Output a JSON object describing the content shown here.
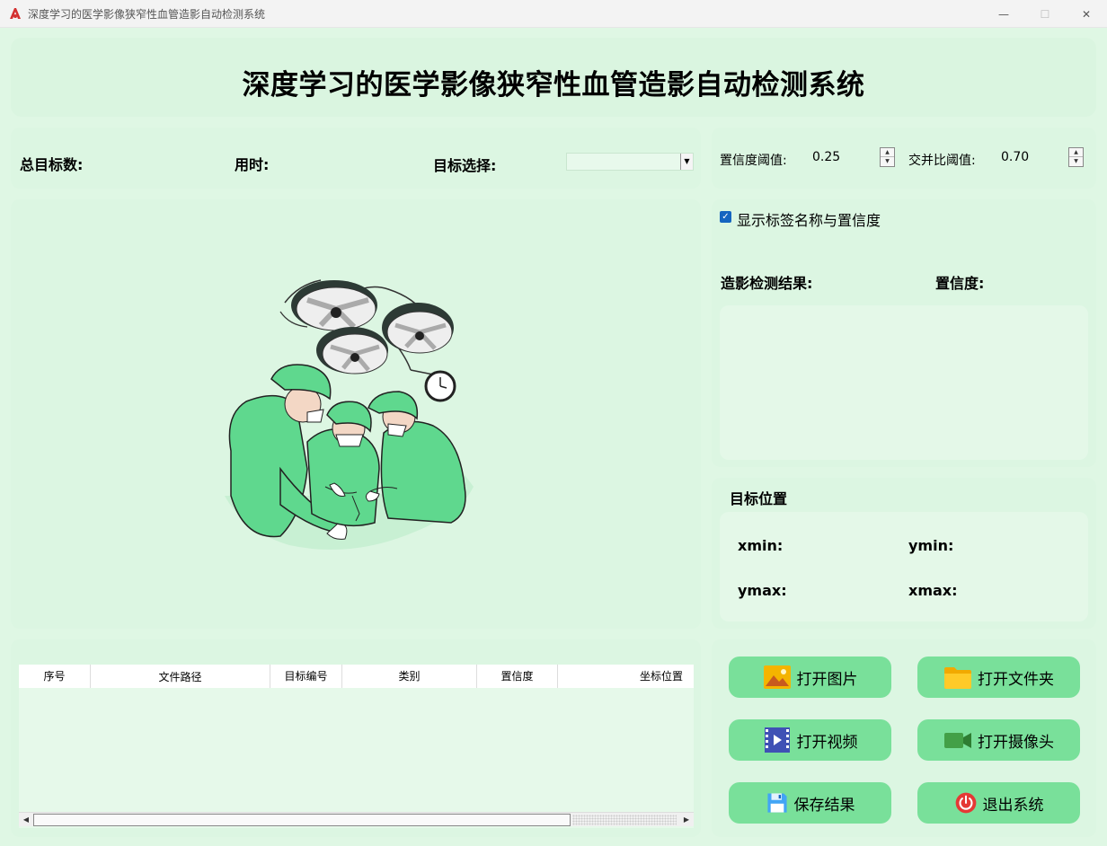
{
  "window": {
    "title": "深度学习的医学影像狭窄性血管造影自动检测系统",
    "minimize": "—",
    "maximize": "☐",
    "close": "✕"
  },
  "header": {
    "title": "深度学习的医学影像狭窄性血管造影自动检测系统"
  },
  "stats": {
    "total_targets_label": "总目标数:",
    "time_label": "用时:",
    "target_select_label": "目标选择:",
    "target_select_value": ""
  },
  "params": {
    "confidence_label": "置信度阈值:",
    "confidence_value": "0.25",
    "iou_label": "交并比阈值:",
    "iou_value": "0.70"
  },
  "results": {
    "show_labels_checkbox": "显示标签名称与置信度",
    "show_labels_checked": true,
    "detection_result_label": "造影检测结果:",
    "confidence_result_label": "置信度:"
  },
  "position": {
    "title": "目标位置",
    "xmin_label": "xmin:",
    "ymin_label": "ymin:",
    "ymax_label": "ymax:",
    "xmax_label": "xmax:"
  },
  "table": {
    "columns": [
      "序号",
      "文件路径",
      "目标编号",
      "类别",
      "置信度",
      "坐标位置"
    ],
    "rows": []
  },
  "buttons": {
    "open_image": "打开图片",
    "open_folder": "打开文件夹",
    "open_video": "打开视频",
    "open_camera": "打开摄像头",
    "save_results": "保存结果",
    "exit_system": "退出系统"
  },
  "colors": {
    "background": "#dff7e4",
    "panel": "#dcf6e2",
    "button": "#79e09a",
    "scrubs": "#5fd88e",
    "checkbox": "#1565c0"
  }
}
